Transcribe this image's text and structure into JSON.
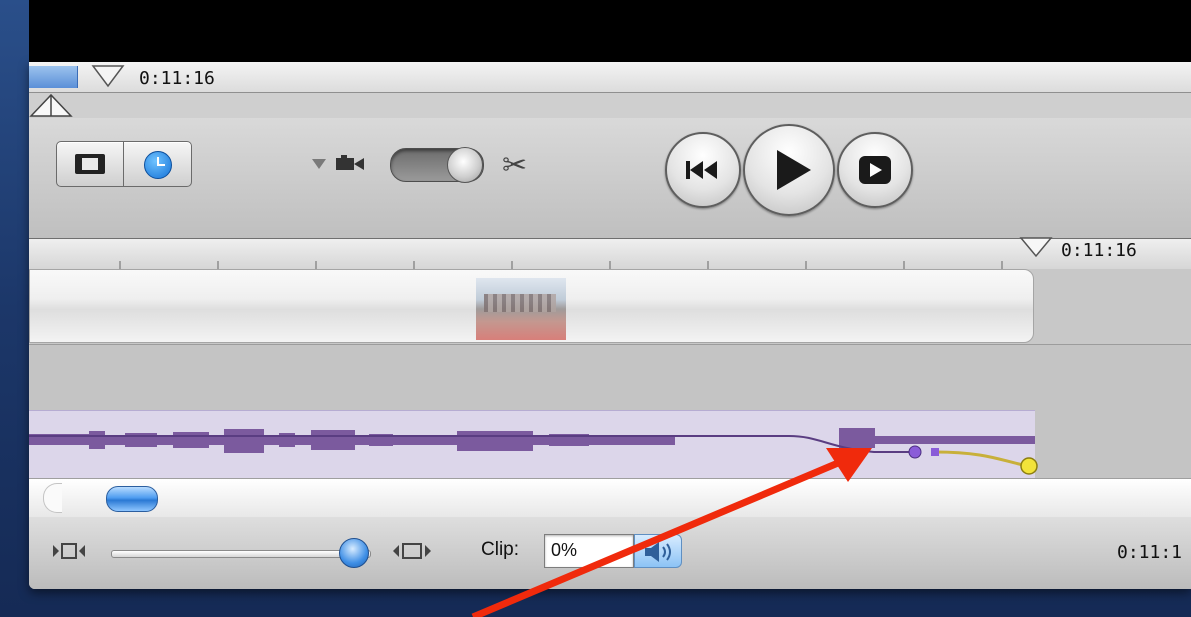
{
  "scrubber": {
    "time": "0:11:16"
  },
  "ruler": {
    "playhead_time": "0:11:16"
  },
  "toolbar": {
    "view_clip_icon": "filmstrip-icon",
    "view_time_icon": "clock-icon",
    "camera_icon": "camera-icon",
    "edit_mode_toggle": "toggle",
    "split_icon": "scissors-icon",
    "transport": [
      "rewind-to-start",
      "play",
      "play-fullscreen"
    ]
  },
  "bottom": {
    "clip_label": "Clip:",
    "clip_volume_value": "0%",
    "zoom_level": 1.0,
    "total_time": "0:11:1"
  },
  "colors": {
    "audio_volume_line": "#6a4a8e",
    "audio_waveform": "#7b5a9e",
    "audio_fade_line": "#c8b03a",
    "annotation_arrow": "#f02a0c",
    "selection_blue": "#2a79d4"
  }
}
